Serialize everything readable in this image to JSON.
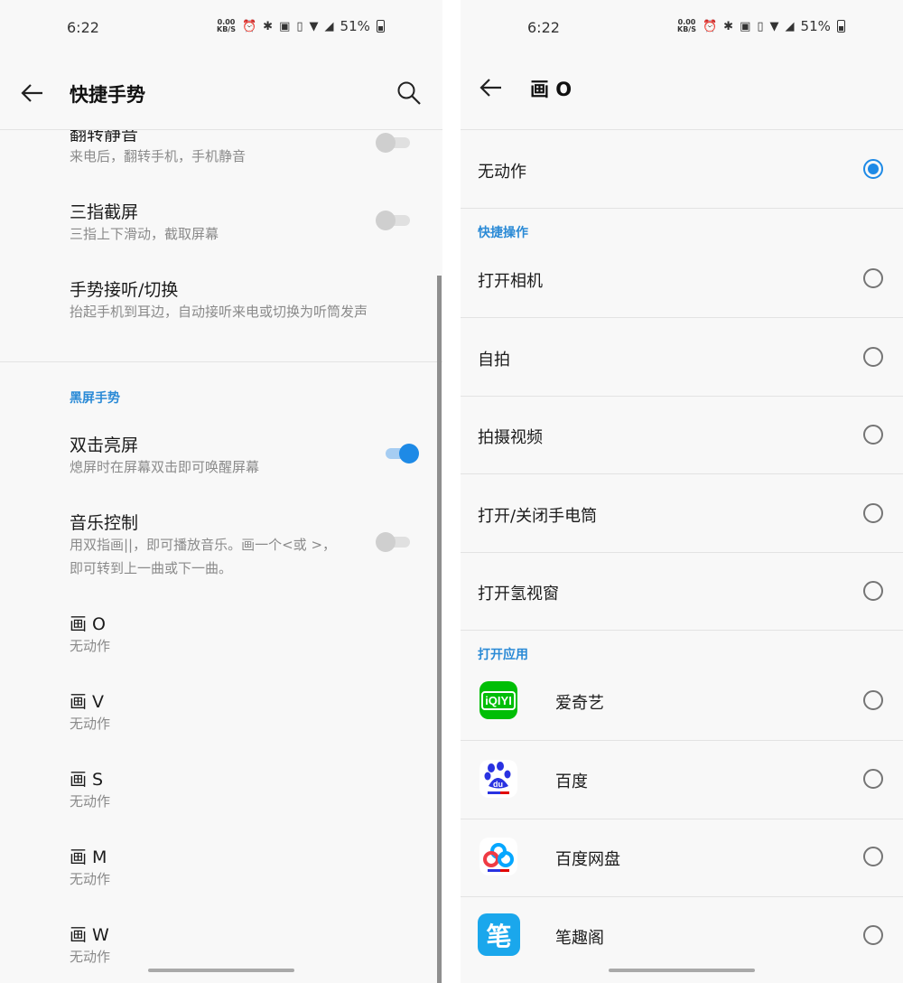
{
  "status_bar": {
    "time": "6:22",
    "net_speed_value": "0.00",
    "net_speed_unit": "KB/S",
    "battery_percent": "51%"
  },
  "left": {
    "header": {
      "title": "快捷手势"
    },
    "items": [
      {
        "title": "翻转静音",
        "subtitle": "来电后，翻转手机，手机静音",
        "toggle": false
      },
      {
        "title": "三指截屏",
        "subtitle": "三指上下滑动，截取屏幕",
        "toggle": false
      },
      {
        "title": "手势接听/切换",
        "subtitle": "抬起手机到耳边，自动接听来电或切换为听筒发声"
      }
    ],
    "section_title": "黑屏手势",
    "screen_off": [
      {
        "title": "双击亮屏",
        "subtitle": "熄屏时在屏幕双击即可唤醒屏幕",
        "toggle": true
      },
      {
        "title": "音乐控制",
        "subtitle": "用双指画||，即可播放音乐。画一个<或 >，即可转到上一曲或下一曲。",
        "toggle": false
      }
    ],
    "draw_gestures": [
      {
        "title": "画 O",
        "subtitle": "无动作"
      },
      {
        "title": "画 V",
        "subtitle": "无动作"
      },
      {
        "title": "画 S",
        "subtitle": "无动作"
      },
      {
        "title": "画 M",
        "subtitle": "无动作"
      },
      {
        "title": "画 W",
        "subtitle": "无动作"
      }
    ]
  },
  "right": {
    "header": {
      "title": "画 O"
    },
    "no_action": {
      "label": "无动作",
      "selected": true
    },
    "quick_section": "快捷操作",
    "quick_actions": [
      {
        "label": "打开相机",
        "selected": false
      },
      {
        "label": "自拍",
        "selected": false
      },
      {
        "label": "拍摄视频",
        "selected": false
      },
      {
        "label": "打开/关闭手电筒",
        "selected": false
      },
      {
        "label": "打开氢视窗",
        "selected": false
      }
    ],
    "apps_section": "打开应用",
    "apps": [
      {
        "label": "爱奇艺",
        "icon": "iqiyi-icon",
        "icon_text": "iQIYI",
        "color": "#00be06",
        "selected": false
      },
      {
        "label": "百度",
        "icon": "baidu-icon",
        "icon_text": "du",
        "color": "#2932e1",
        "selected": false
      },
      {
        "label": "百度网盘",
        "icon": "baidu-netdisk-icon",
        "color": "#06a7ff",
        "selected": false
      },
      {
        "label": "笔趣阁",
        "icon": "biquge-icon",
        "icon_text": "笔",
        "color": "#1aa7ec",
        "selected": false
      }
    ]
  },
  "colors": {
    "accent": "#1e8ae6",
    "section": "#2a8ad6",
    "background": "#f8f8f8"
  }
}
